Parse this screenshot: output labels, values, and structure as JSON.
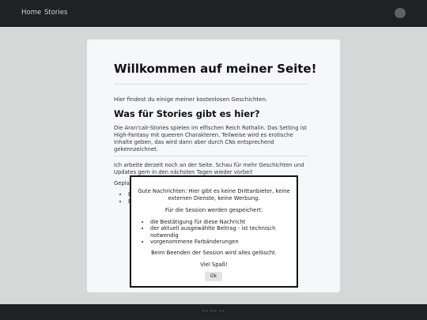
{
  "nav": {
    "home": "Home",
    "stories": "Stories"
  },
  "main": {
    "title": "Willkommen auf meiner Seite!",
    "intro": "Hier findest du einige meiner kostenlosen Geschichten.",
    "section_title": "Was für Stories gibt es hier?",
    "section_text": "Die Aran'caîr-Stories spielen im elfischen Reich Rothalin. Das Setting ist High-Fantasy mit queeren Charakteren. Teilweise wird es erotische Inhalte geben, das wird dann aber durch CNs entsprechend gekennzeichnet.",
    "update_text": "Ich arbeite derzeit noch an der Seite. Schau für mehr Geschichten und Updates gern in den nächsten Tagen wieder vorbei!",
    "planned_label": "Gepla",
    "planned_items": [
      "E",
      "B"
    ]
  },
  "modal": {
    "line1": "Gute Nachrichten: Hier gibt es keine Drittanbieter, keine externen Dienste, keine Werbung.",
    "line2": "Für die Session werden gespeichert:",
    "items": [
      "die Bestätigung für diese Nachricht",
      "der aktuell ausgewählte Beitrag - ist technisch notwendig",
      "vorgenommene Farbänderungen"
    ],
    "line3": "Beim Beenden der Session wird alles gelöscht.",
    "line4": "Viel Spaß!",
    "ok_label": "Ok"
  },
  "footer": {
    "text": "~~ ~~ ~~"
  }
}
